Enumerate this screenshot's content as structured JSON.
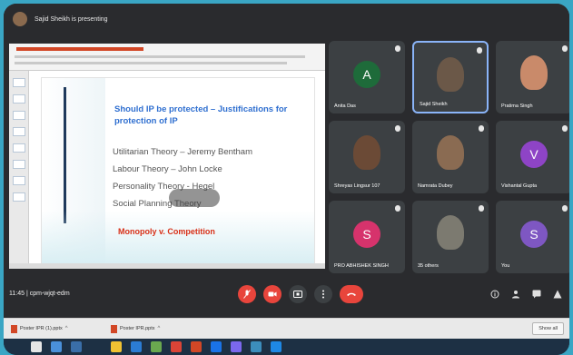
{
  "topbar": {
    "presenting_text": "Sajid Sheikh is presenting"
  },
  "slide": {
    "title": "Should IP be protected – Justifications for protection of IP",
    "bullets": [
      "Utilitarian Theory – Jeremy Bentham",
      "Labour Theory – John Locke",
      "Personality Theory - Hegel",
      "Social Planning Theory"
    ],
    "footer": "Monopoly v. Competition"
  },
  "participants": [
    {
      "name": "Anita Das",
      "initial": "A",
      "color": "#1e6b3a",
      "type": "avatar"
    },
    {
      "name": "Sajid Sheikh",
      "initial": "",
      "color": "#6b5848",
      "type": "photo",
      "active": true
    },
    {
      "name": "Pratima Singh",
      "initial": "",
      "color": "#c98a6a",
      "type": "photo"
    },
    {
      "name": "Shreyas Lingsur 107",
      "initial": "",
      "color": "#6b4a36",
      "type": "photo"
    },
    {
      "name": "Namrata Dubey",
      "initial": "",
      "color": "#8a6b52",
      "type": "photo"
    },
    {
      "name": "Vishantal Gupta",
      "initial": "V",
      "color": "#8e44c6",
      "type": "avatar"
    },
    {
      "name": "PRO ABHISHEK SINGH",
      "initial": "S",
      "color": "#d6336c",
      "type": "avatar"
    },
    {
      "name": "35 others",
      "initial": "",
      "color": "#7c7a70",
      "type": "photo"
    },
    {
      "name": "You",
      "initial": "S",
      "color": "#7e57c2",
      "type": "avatar"
    }
  ],
  "bottombar": {
    "meeting_info": "11:45  |  cpm-wjqt-edm"
  },
  "downloads": {
    "items": [
      "Poster IPR (1).pptx",
      "Poster IPR.pptx"
    ],
    "show_all": "Show all"
  }
}
